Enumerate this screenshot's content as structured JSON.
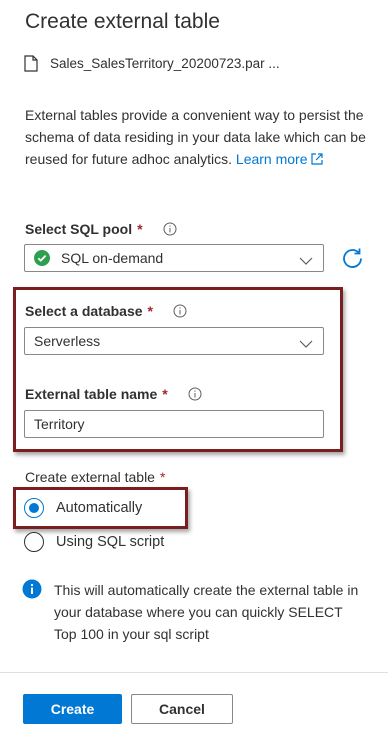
{
  "panel": {
    "title": "Create external table",
    "file_name": "Sales_SalesTerritory_20200723.par ...",
    "description": "External tables provide a convenient way to persist the schema of data residing in your data lake which can be reused for future adhoc analytics.",
    "learn_more": "Learn more"
  },
  "sql_pool": {
    "label": "Select SQL pool",
    "required_mark": "*",
    "value": "SQL on-demand",
    "status_color": "#2e9e4f"
  },
  "database": {
    "label": "Select a database",
    "required_mark": "*",
    "value": "Serverless"
  },
  "table_name": {
    "label": "External table name",
    "required_mark": "*",
    "value": "Territory"
  },
  "create_mode": {
    "label": "Create external table",
    "required_mark": "*",
    "options": [
      {
        "label": "Automatically",
        "selected": true
      },
      {
        "label": "Using SQL script",
        "selected": false
      }
    ]
  },
  "info_note": "This will automatically create the external table in your database where you can quickly SELECT Top 100 in your sql script",
  "buttons": {
    "create": "Create",
    "cancel": "Cancel"
  },
  "colors": {
    "accent": "#0078d4",
    "highlight_border": "#7a1f1f",
    "required": "#a4262c"
  }
}
